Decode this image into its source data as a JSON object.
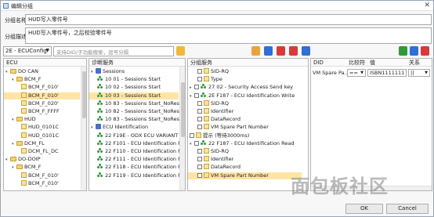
{
  "window": {
    "title": "编辑分组"
  },
  "form": {
    "name_label": "分组名称",
    "name_value": "HUD写入零件号",
    "desc_label": "分组描述",
    "desc_value": "HUD写入零件号，之后校验零件号"
  },
  "toolbar": {
    "ecu_select": "2E - ECUConfig",
    "search_placeholder": "支持DID/子功能搜索，逗号分隔"
  },
  "ecu_pane": {
    "header": "ECU",
    "items": [
      {
        "label": "DO CAN"
      },
      {
        "label": "BCM_F"
      },
      {
        "label": "BCM_F_010'"
      },
      {
        "label": "BCM_F_010'"
      },
      {
        "label": "BCM_F_020'"
      },
      {
        "label": "BCM_F_FFFF"
      },
      {
        "label": "HUD"
      },
      {
        "label": "HUD_0101C"
      },
      {
        "label": "HUD_0101C"
      },
      {
        "label": "DCM_FL"
      },
      {
        "label": "DCM_FL_DC"
      },
      {
        "label": "DO-DOIP"
      },
      {
        "label": "BCM_F"
      },
      {
        "label": "BCM_F_010'"
      },
      {
        "label": "BCM_F_010'"
      }
    ]
  },
  "svc_pane": {
    "header": "诊断服务",
    "items": [
      {
        "label": "Sessions"
      },
      {
        "label": "10 01 - Sessions Start"
      },
      {
        "label": "10 02 - Sessions Start"
      },
      {
        "label": "10 03 - Sessions Start"
      },
      {
        "label": "10 83 - Sessions Start_NoResp"
      },
      {
        "label": "10 82 - Sessions Start_NoResp"
      },
      {
        "label": "10 83 - Sessions Start_NoResp"
      },
      {
        "label": "ECU Identification"
      },
      {
        "label": "22 F19E - ODX ECU VARIANT"
      },
      {
        "label": "22 F101 - ECU Identification Re"
      },
      {
        "label": "22 F110 - ECU Identification Re"
      },
      {
        "label": "22 F111 - ECU Identification Re"
      },
      {
        "label": "22 F118 - ECU Identification Re"
      },
      {
        "label": "22 F119 - ECU Identification Re"
      }
    ]
  },
  "group_pane": {
    "header": "分组服务",
    "items": [
      {
        "label": "SID-RQ"
      },
      {
        "label": "Type"
      },
      {
        "label": "27 02 - Security Access Send key"
      },
      {
        "label": "2E F187 - ECU Identification Write"
      },
      {
        "label": "SID-RQ"
      },
      {
        "label": "Identifier"
      },
      {
        "label": "DataRecord"
      },
      {
        "label": "VM Spare Part Number"
      },
      {
        "label": "提示 (等待3000ms)"
      },
      {
        "label": "22 F187 - ECU Identification Read"
      },
      {
        "label": "SID-RQ"
      },
      {
        "label": "Identifier"
      },
      {
        "label": "DataRecord"
      },
      {
        "label": "VM Spare Part Number"
      }
    ]
  },
  "param_pane": {
    "col_did": "DID",
    "col_cmp": "比较符",
    "col_val": "值",
    "col_rel": "关系",
    "row": {
      "did": "VM Spare Pa...",
      "cmp": "==",
      "val": "ISBN1111111",
      "rel": "||"
    }
  },
  "footer": {
    "ok": "OK",
    "cancel": "Cancel"
  },
  "watermark": "面包板社区",
  "colors": {
    "selected": "#ffe4a3",
    "folder": "#e8c15a",
    "green": "#2f9a3a"
  }
}
